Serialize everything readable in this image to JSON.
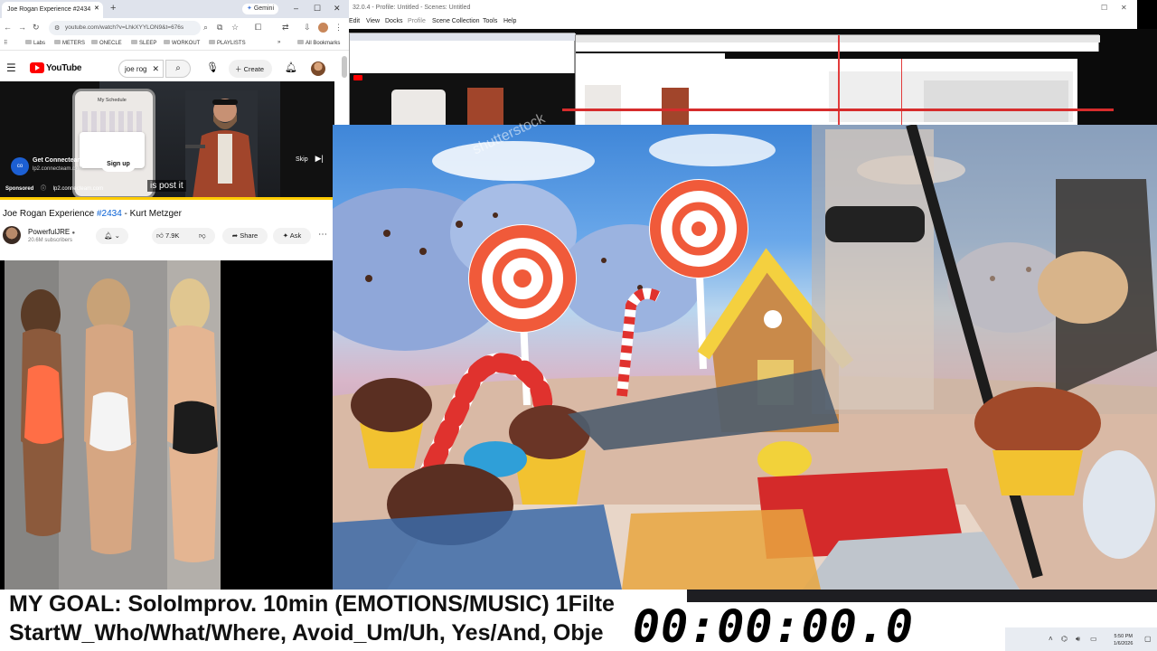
{
  "browser": {
    "tab_title": "Joe Rogan Experience #2434",
    "new_tab": "+",
    "gemini": "Gemini",
    "address": "youtube.com/watch?v=LhkXYYLON9&t=676s",
    "bookmarks": [
      "Labs",
      "METERS",
      "ONECLE",
      "SLEEP",
      "WORKOUT",
      "PLAYLISTS",
      "All Bookmarks"
    ]
  },
  "youtube": {
    "logo_text": "YouTube",
    "search_value": "joe rog",
    "create_label": "Create",
    "ad": {
      "name": "Get Connecteam",
      "url": "lp2.connecteam.com",
      "signup": "Sign up",
      "skip": "Skip",
      "sponsored": "Sponsored",
      "sponsored_url": "lp2.connecteam.com",
      "phone_title": "My Schedule"
    },
    "subtitle": "is post it",
    "progress": 1.0,
    "title_prefix": "Joe Rogan Experience ",
    "title_tag": "#2434",
    "title_suffix": " - Kurt Metzger",
    "channel": "PowerfulJRE",
    "subscribers": "20.6M subscribers",
    "likes": "7.9K",
    "share": "Share",
    "ask": "Ask"
  },
  "obs": {
    "title": "32.0.4 - Profile: Untitled - Scenes: Untitled",
    "menu": [
      "Edit",
      "View",
      "Docks",
      "Profile",
      "Scene Collection",
      "Tools",
      "Help"
    ]
  },
  "banner": {
    "goal_line1": "MY GOAL: SoloImprov. 10min (EMOTIONS/MUSIC) 1Filte",
    "goal_line2": "StartW_Who/What/Where, Avoid_Um/Uh, Yes/And, Obje",
    "timer": "00:00:00.0"
  },
  "taskbar": {
    "time": "5:50 PM",
    "date": "1/6/2026"
  },
  "colors": {
    "youtube_red": "#ff0000",
    "progress_yellow": "#ffcc00",
    "link_blue": "#065fd4"
  }
}
